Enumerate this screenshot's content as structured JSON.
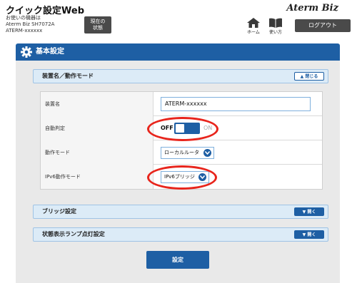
{
  "header": {
    "app_title": "クイック設定Web",
    "device_line1": "お使いの機器は",
    "device_line2": "Aterm Biz SH7072A",
    "device_line3": "ATERM-xxxxxx",
    "status_btn_line1": "現在の",
    "status_btn_line2": "状態",
    "brand": "Aterm Biz",
    "home_label": "ホーム",
    "help_label": "使い方",
    "logout_label": "ログアウト"
  },
  "section": {
    "title": "基本設定"
  },
  "accordions": {
    "device": {
      "label": "装置名／動作モード",
      "button": "閉じる"
    },
    "bridge": {
      "label": "ブリッジ設定",
      "button": "開く"
    },
    "lamp": {
      "label": "状態表示ランプ点灯設定",
      "button": "開く"
    }
  },
  "rows": {
    "device_name": {
      "label": "装置名",
      "value": "ATERM-xxxxxx"
    },
    "auto_detect": {
      "label": "自動判定",
      "off": "OFF",
      "on": "ON",
      "state": "off"
    },
    "mode": {
      "label": "動作モード",
      "value": "ローカルルータ"
    },
    "ipv6_mode": {
      "label": "IPv6動作モード",
      "value": "IPv6ブリッジ"
    }
  },
  "submit_label": "設定",
  "colors": {
    "accent": "#1e5fa4",
    "highlight": "#e8251c",
    "accordion_bg": "#dcebf7"
  }
}
